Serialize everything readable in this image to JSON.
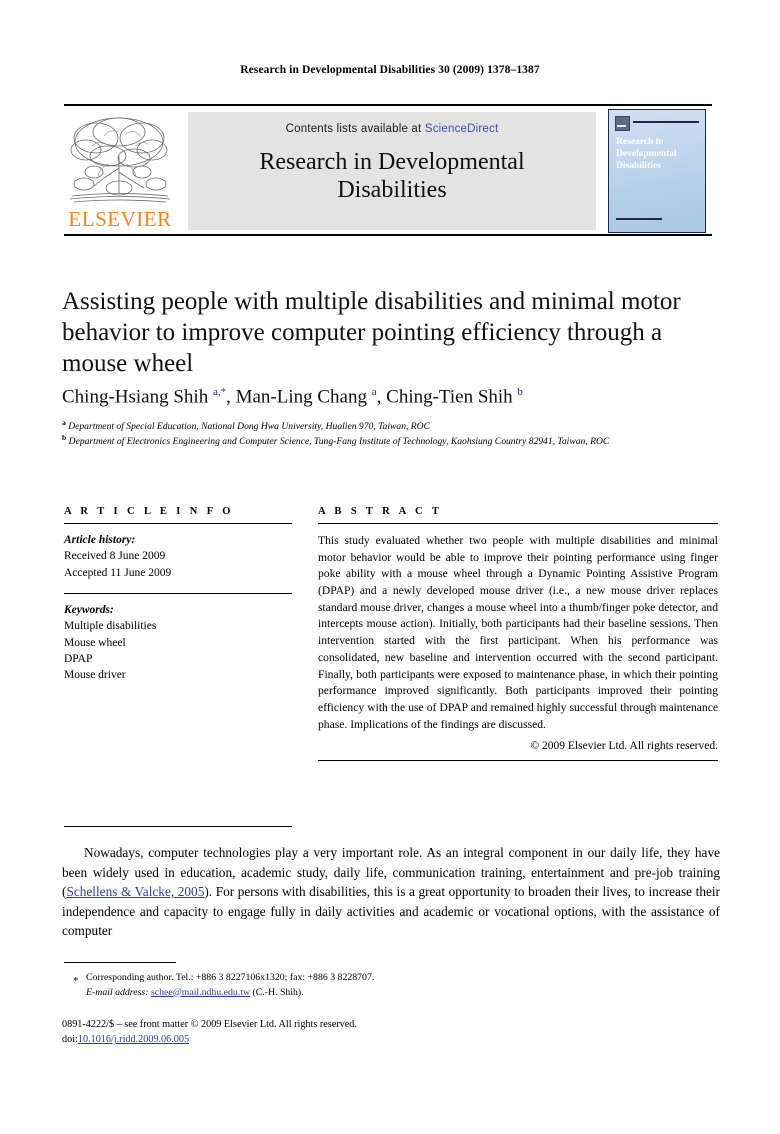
{
  "running_head": "Research in Developmental Disabilities 30 (2009) 1378–1387",
  "masthead": {
    "publisher": "ELSEVIER",
    "contents_prefix": "Contents lists available at ",
    "contents_link": "ScienceDirect",
    "journal_name_line1": "Research in Developmental",
    "journal_name_line2": "Disabilities",
    "cover_title": "Research in Developmental Disabilities"
  },
  "article": {
    "title": "Assisting people with multiple disabilities and minimal motor behavior to improve computer pointing efficiency through a mouse wheel",
    "authors_html": "Ching-Hsiang Shih <sup>a,*</sup>, Man-Ling Chang <sup>a</sup>, Ching-Tien Shih <sup>b</sup>",
    "affiliation_a": "Department of Special Education, National Dong Hwa University, Hualien 970, Taiwan, ROC",
    "affiliation_b": "Department of Electronics Engineering and Computer Science, Tung-Fang Institute of Technology, Kaohsiung Country 82941, Taiwan, ROC"
  },
  "info": {
    "heading": "A R T I C L E    I N F O",
    "history_label": "Article history:",
    "history": [
      "Received 8 June 2009",
      "Accepted 11 June 2009"
    ],
    "keywords_label": "Keywords:",
    "keywords": [
      "Multiple disabilities",
      "Mouse wheel",
      "DPAP",
      "Mouse driver"
    ]
  },
  "abstract": {
    "heading": "A B S T R A C T",
    "text": "This study evaluated whether two people with multiple disabilities and minimal motor behavior would be able to improve their pointing performance using finger poke ability with a mouse wheel through a Dynamic Pointing Assistive Program (DPAP) and a newly developed mouse driver (i.e., a new mouse driver replaces standard mouse driver, changes a mouse wheel into a thumb/finger poke detector, and intercepts mouse action). Initially, both participants had their baseline sessions. Then intervention started with the first participant. When his performance was consolidated, new baseline and intervention occurred with the second participant. Finally, both participants were exposed to maintenance phase, in which their pointing performance improved significantly. Both participants improved their pointing efficiency with the use of DPAP and remained highly successful through maintenance phase. Implications of the findings are discussed.",
    "copyright": "© 2009 Elsevier Ltd. All rights reserved."
  },
  "body": {
    "paragraph_part1": "Nowadays, computer technologies play a very important role. As an integral component in our daily life, they have been widely used in education, academic study, daily life, communication training, entertainment and pre-job training (",
    "citation": "Schellens & Valcke, 2005",
    "paragraph_part2": "). For persons with disabilities, this is a great opportunity to broaden their lives, to increase their independence and capacity to engage fully in daily activities and academic or vocational options, with the assistance of computer"
  },
  "footnote": {
    "marker": "*",
    "corresponding": "Corresponding author. Tel.: +886 3 8227106x1320; fax: +886 3 8228707.",
    "email_label": "E-mail address:",
    "email": "schee@mail.ndhu.edu.tw",
    "email_suffix": " (C.-H. Shih)."
  },
  "imprint": {
    "line1": "0891-4222/$ – see front matter © 2009 Elsevier Ltd. All rights reserved.",
    "doi_label": "doi:",
    "doi": "10.1016/j.ridd.2009.06.005"
  },
  "colors": {
    "elsevier_orange": "#F6821F",
    "link_blue": "#2c3f8f",
    "sciencedirect_blue": "#3a4fb5",
    "banner_grey": "#E3E3E3"
  }
}
